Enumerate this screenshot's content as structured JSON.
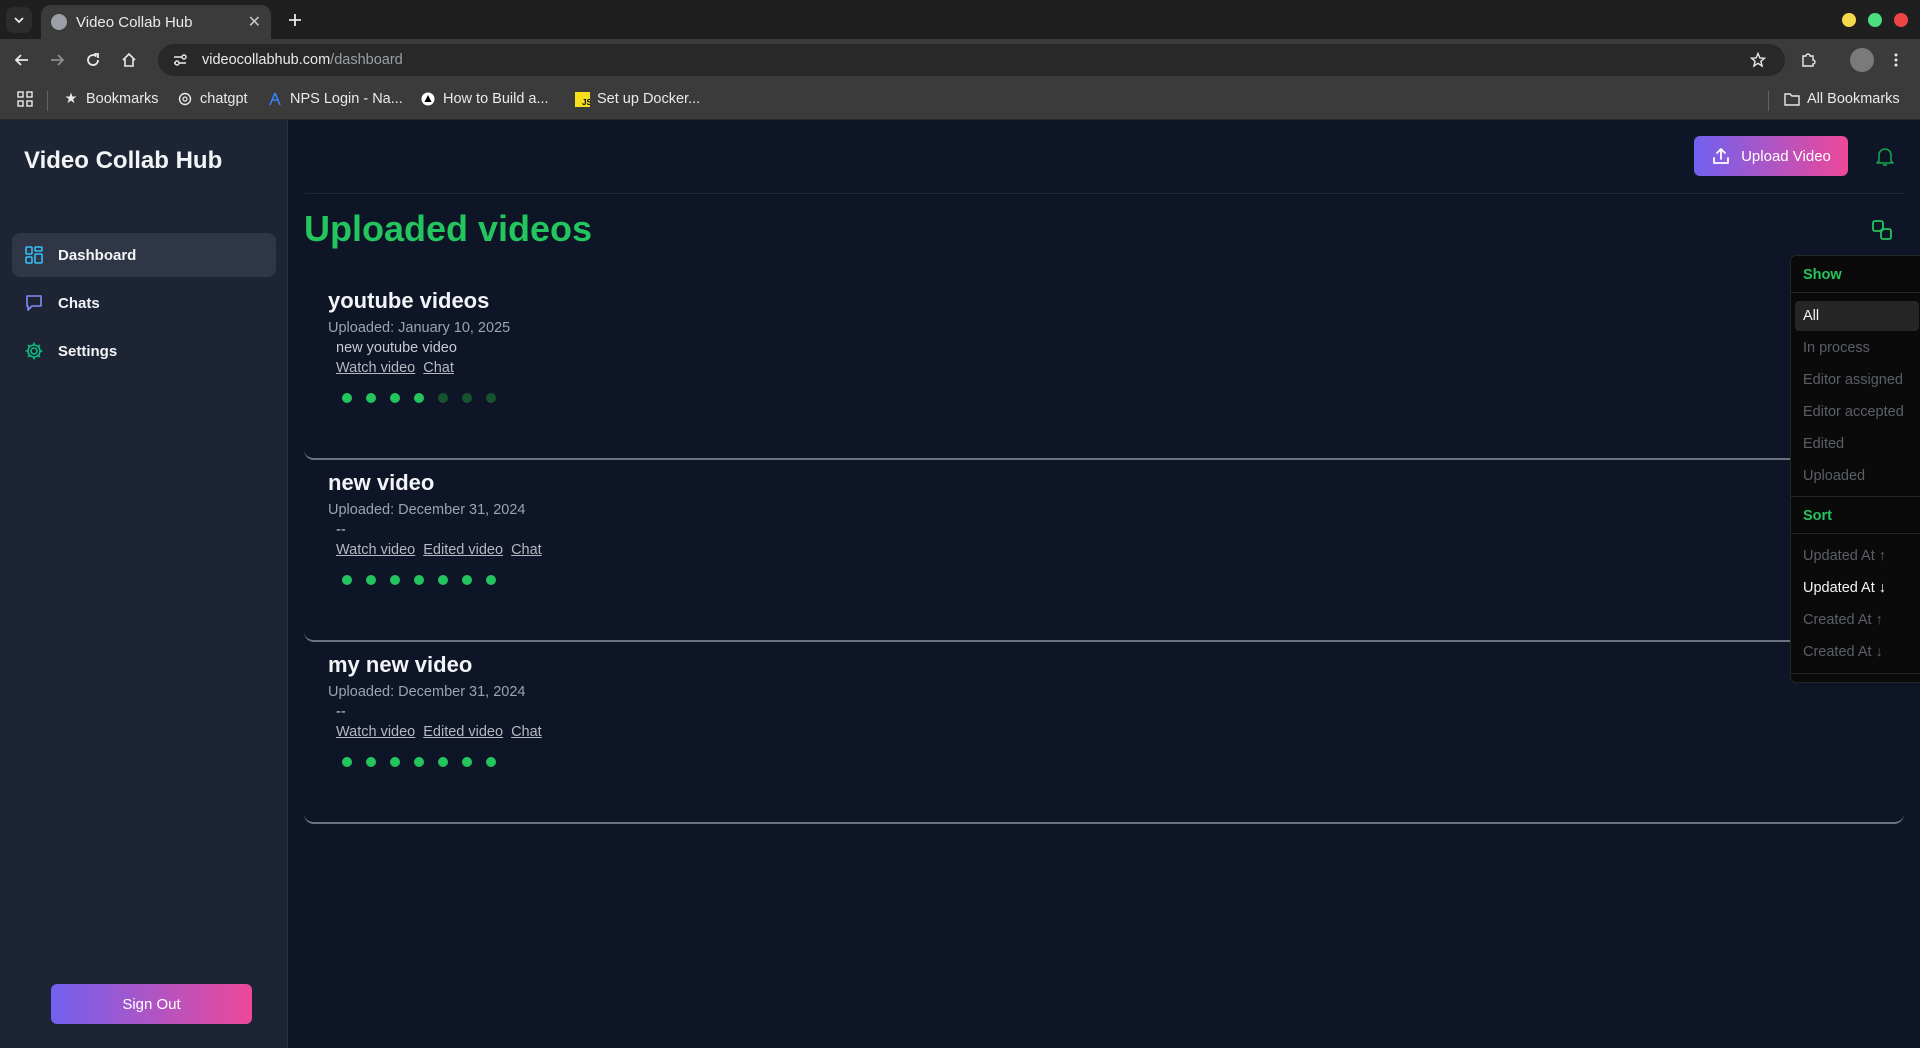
{
  "browser": {
    "tab_title": "Video Collab Hub",
    "url_host": "videocollabhub.com",
    "url_path": "/dashboard",
    "bookmarks": [
      "Bookmarks",
      "chatgpt",
      "NPS Login - Na...",
      "How to Build a...",
      "Set up Docker..."
    ],
    "all_bookmarks": "All Bookmarks"
  },
  "sidebar": {
    "brand": "Video Collab Hub",
    "items": [
      {
        "label": "Dashboard",
        "icon": "dashboard-icon",
        "active": true
      },
      {
        "label": "Chats",
        "icon": "chat-icon",
        "active": false
      },
      {
        "label": "Settings",
        "icon": "gear-icon",
        "active": false
      }
    ],
    "sign_out": "Sign Out"
  },
  "header": {
    "upload_label": "Upload Video"
  },
  "main": {
    "title": "Uploaded videos"
  },
  "videos": [
    {
      "title": "youtube videos",
      "date": "Uploaded: January 10, 2025",
      "desc": "new youtube video",
      "links": [
        "Watch video",
        "Chat"
      ],
      "progress_steps_completed": 4,
      "progress_steps_total": 7
    },
    {
      "title": "new video",
      "date": "Uploaded: December 31, 2024",
      "desc": "--",
      "links": [
        "Watch video",
        "Edited video",
        "Chat"
      ],
      "progress_steps_completed": 7,
      "progress_steps_total": 7
    },
    {
      "title": "my new video",
      "date": "Uploaded: December 31, 2024",
      "desc": "--",
      "links": [
        "Watch video",
        "Edited video",
        "Chat"
      ],
      "progress_steps_completed": 7,
      "progress_steps_total": 7
    }
  ],
  "dropdown": {
    "show_label": "Show",
    "show_options": [
      "All",
      "In process",
      "Editor assigned",
      "Editor accepted",
      "Edited",
      "Uploaded"
    ],
    "show_selected": "All",
    "sort_label": "Sort",
    "sort_options": [
      "Updated At ↑",
      "Updated At ↓",
      "Created At ↑",
      "Created At ↓"
    ],
    "sort_selected": "Updated At ↓"
  },
  "colors": {
    "accent_green": "#22c55e",
    "gradient_start": "#7161ef",
    "gradient_end": "#ec4899",
    "sidebar_bg": "#1d2434",
    "main_bg": "#0e1527"
  }
}
